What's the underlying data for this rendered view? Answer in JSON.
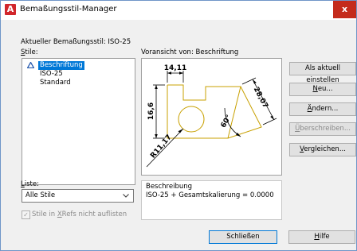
{
  "window": {
    "title": "Bemaßungsstil-Manager",
    "close_glyph": "x"
  },
  "current_style": {
    "label": "Aktueller Bemaßungsstil:",
    "value": "ISO-25"
  },
  "styles": {
    "label_first": "S",
    "label_rest": "tile:",
    "items": [
      {
        "label": "Beschriftung",
        "selected": true,
        "icon": "annotative-triangle-icon"
      },
      {
        "label": "ISO-25",
        "selected": false
      },
      {
        "label": "Standard",
        "selected": false
      }
    ]
  },
  "preview": {
    "label": "Voransicht von: Beschriftung",
    "dims": {
      "top": "14,11",
      "left": "16,6",
      "diag": "28,07",
      "angle": "60°",
      "radius": "R11,17"
    }
  },
  "list_filter": {
    "label_first": "L",
    "label_rest": "iste:",
    "selected": "Alle Stile"
  },
  "xref_checkbox": {
    "checked": true,
    "before": "Stile in ",
    "key": "X",
    "after": "Refs nicht auflisten"
  },
  "description": {
    "heading": "Beschreibung",
    "text": "ISO-25 + Gesamtskalierung = 0.0000"
  },
  "buttons": {
    "set_current": {
      "label": "Als aktuell einstellen"
    },
    "new": {
      "key": "N",
      "rest": "eu..."
    },
    "modify": {
      "key": "Ä",
      "rest": "ndern..."
    },
    "override": {
      "key": "Ü",
      "rest": "berschreiben..."
    },
    "compare": {
      "key": "V",
      "rest": "ergleichen..."
    },
    "close": {
      "label": "Schließen"
    },
    "help": {
      "key": "H",
      "rest": "ilfe"
    }
  },
  "colors": {
    "accent_blue": "#0078d7",
    "close_red": "#c42b1c",
    "app_red": "#d1262b",
    "geometry_gold": "#c8a000",
    "window_bg": "#f0f0f0"
  }
}
